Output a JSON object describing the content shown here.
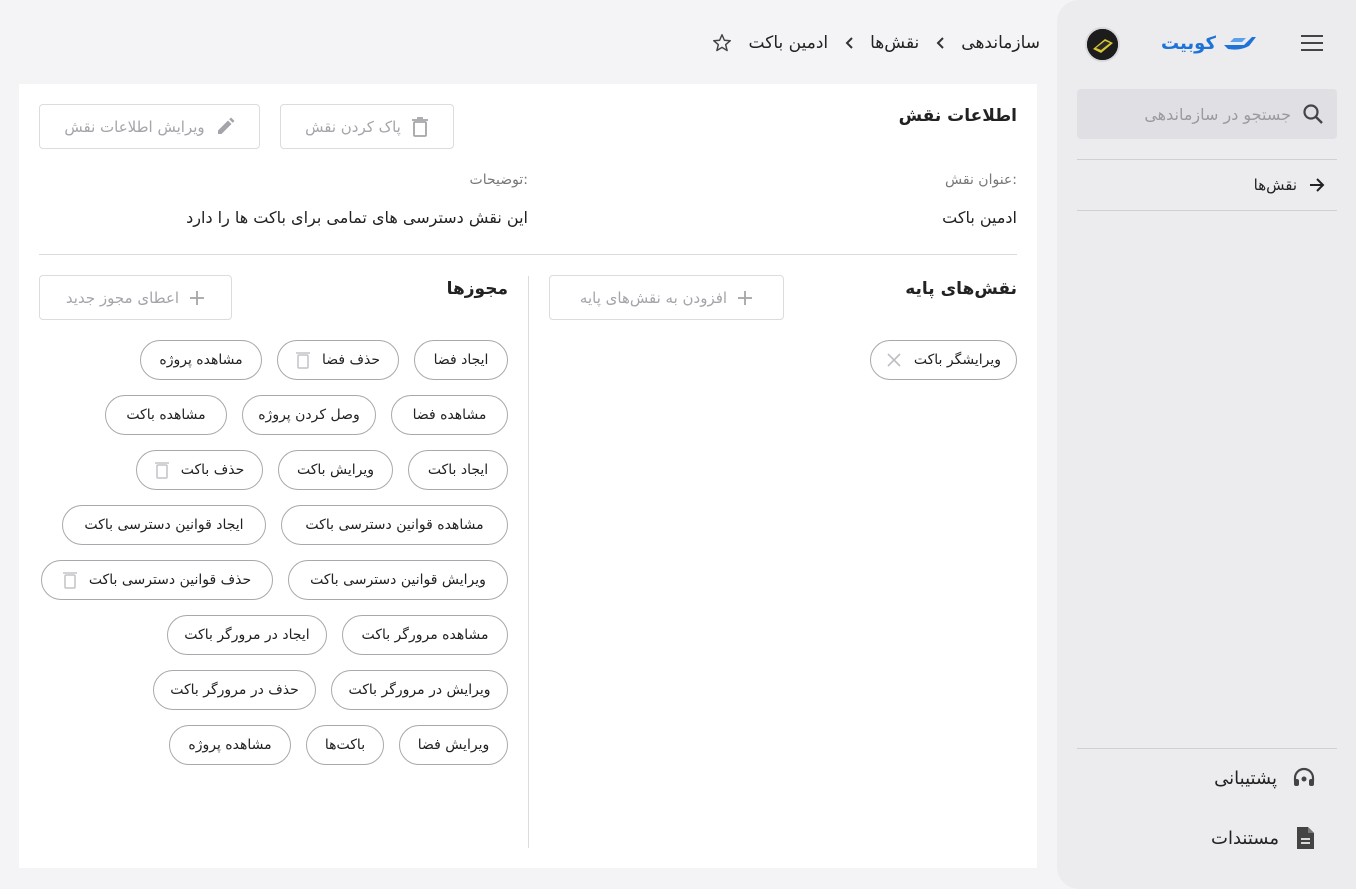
{
  "sidebar": {
    "brand": "کوبیت",
    "search_placeholder": "جستجو در سازماندهی",
    "nav": [
      {
        "label": "نقش‌ها",
        "icon": "arrow-right-icon"
      }
    ],
    "footer": [
      {
        "label": "پشتیبانی",
        "icon": "headset-icon"
      },
      {
        "label": "مستندات",
        "icon": "document-icon"
      }
    ]
  },
  "breadcrumb": [
    "سازماندهی",
    "نقش‌ها",
    "ادمین باکت"
  ],
  "card": {
    "title": "اطلاعات نقش",
    "delete_label": "پاک کردن نقش",
    "edit_label": "ویرایش اطلاعات نقش",
    "name_label": "عنوان نقش:",
    "name_value": "ادمین باکت",
    "desc_label": "توضیحات:",
    "desc_value": "این نقش دسترسی های تمامی برای باکت ها را دارد"
  },
  "base_roles": {
    "title": "نقش‌های پایه",
    "add_label": "افزودن به نقش‌های پایه",
    "items": [
      "ویرایشگر باکت"
    ]
  },
  "permissions": {
    "title": "مجوزها",
    "add_label": "اعطای مجوز جدید",
    "rows": [
      [
        "ایجاد فضا",
        "حذف فضا",
        "مشاهده پروژه"
      ],
      [
        "مشاهده فضا",
        "وصل کردن پروژه",
        "مشاهده باکت"
      ],
      [
        "ایجاد باکت",
        "ویرایش باکت",
        "حذف باکت"
      ],
      [
        "مشاهده قوانین دسترسی باکت",
        "ایجاد قوانین دسترسی باکت"
      ],
      [
        "ویرایش قوانین دسترسی باکت",
        "حذف قوانین دسترسی باکت"
      ],
      [
        "مشاهده مرورگر باکت",
        "ایجاد در مرورگر باکت"
      ],
      [
        "ویرایش در مرورگر باکت",
        "حذف در مرورگر باکت"
      ],
      [
        "ویرایش فضا",
        "باکت‌ها",
        "مشاهده پروژه"
      ]
    ]
  }
}
